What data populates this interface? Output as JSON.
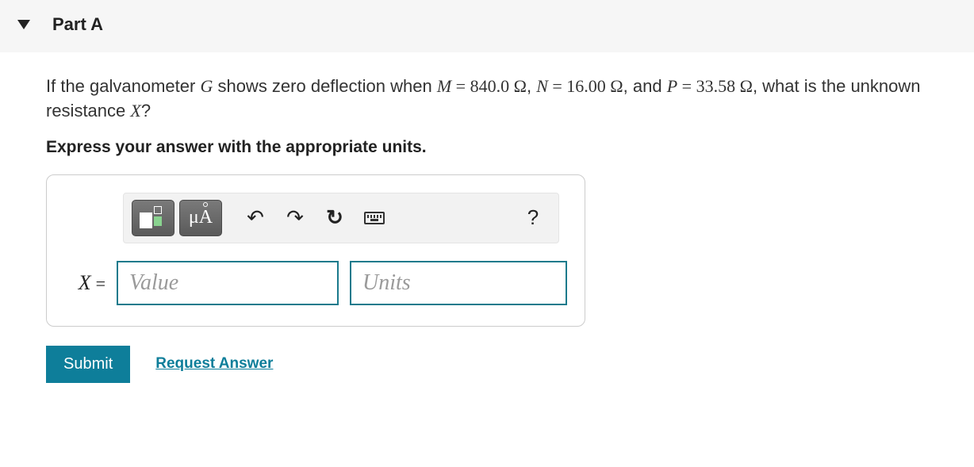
{
  "header": {
    "title": "Part A"
  },
  "question": {
    "pre": "If the galvanometer ",
    "G": "G",
    "mid1": " shows zero deflection when ",
    "M": "M",
    "eq1": " = 840.0 ",
    "ohm": "Ω",
    "sep1": ", ",
    "N": "N",
    "eq2": " = 16.00 ",
    "sep2": ", and ",
    "P": "P",
    "eq3": " = 33.58 ",
    "tail": ", what is the unknown resistance ",
    "X": "X",
    "qmark": "?"
  },
  "instruction": "Express your answer with the appropriate units.",
  "toolbar": {
    "templates_label": "templates",
    "symbols_label": "μÅ",
    "undo": "↶",
    "redo": "↷",
    "reset": "↻",
    "keyboard": "keyboard",
    "help": "?"
  },
  "answer": {
    "variable": "X",
    "equals": "=",
    "value_placeholder": "Value",
    "units_placeholder": "Units"
  },
  "actions": {
    "submit": "Submit",
    "request": "Request Answer"
  }
}
